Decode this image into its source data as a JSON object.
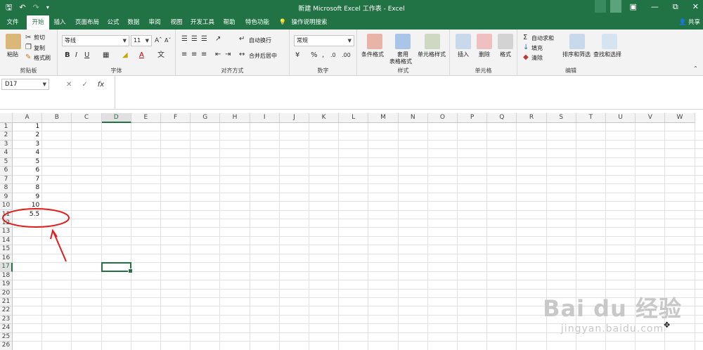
{
  "window": {
    "title": "新建 Microsoft Excel 工作表 - Excel",
    "account": "共享"
  },
  "ribbon_tabs": [
    "文件",
    "开始",
    "插入",
    "页面布局",
    "公式",
    "数据",
    "审阅",
    "视图",
    "开发工具",
    "帮助",
    "特色功能",
    "操作说明搜索"
  ],
  "ribbon": {
    "clipboard": {
      "paste": "粘贴",
      "cut": "剪切",
      "copy": "复制",
      "format_painter": "格式刷",
      "label": "剪贴板"
    },
    "font": {
      "name": "等线",
      "size": "11",
      "label": "字体"
    },
    "alignment": {
      "wrap": "自动换行",
      "merge": "合并后居中",
      "label": "对齐方式"
    },
    "number": {
      "format": "常规",
      "label": "数字"
    },
    "styles": {
      "conditional": "条件格式",
      "table_line1": "套用",
      "table_line2": "表格格式",
      "cell_styles": "单元格样式",
      "label": "样式"
    },
    "cells": {
      "insert": "插入",
      "delete": "删除",
      "format": "格式",
      "label": "单元格"
    },
    "editing": {
      "autosum": "自动求和",
      "fill": "填充",
      "clear": "清除",
      "sort": "排序和筛选",
      "find": "查找和选择",
      "label": "编辑"
    }
  },
  "formula_bar": {
    "name_box": "D17",
    "formula": ""
  },
  "sheet": {
    "columns": [
      "A",
      "B",
      "C",
      "D",
      "E",
      "F",
      "G",
      "H",
      "I",
      "J",
      "K",
      "L",
      "M",
      "N",
      "O",
      "P",
      "Q",
      "R",
      "S",
      "T",
      "U",
      "V",
      "W"
    ],
    "rows": [
      "1",
      "2",
      "3",
      "4",
      "5",
      "6",
      "7",
      "8",
      "9",
      "10",
      "11",
      "12",
      "13",
      "14",
      "15",
      "16",
      "17",
      "18",
      "19",
      "20",
      "21",
      "22",
      "23",
      "24",
      "25",
      "26"
    ],
    "column_a_values": [
      "1",
      "2",
      "3",
      "4",
      "5",
      "6",
      "7",
      "8",
      "9",
      "10",
      "5.5"
    ],
    "active_cell": "D17"
  },
  "watermark": {
    "line1": "Bai du 经验",
    "line2": "jingyan.baidu.com"
  },
  "colors": {
    "excel_green": "#217346",
    "annotation_red": "#e31b1b"
  }
}
